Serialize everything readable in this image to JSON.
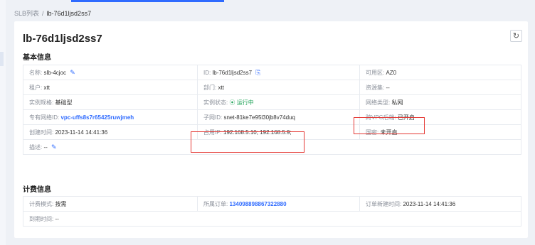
{
  "breadcrumb": {
    "parent": "SLB列表",
    "separator": "/",
    "current": "lb-76d1ljsd2ss7"
  },
  "page_title": "lb-76d1ljsd2ss7",
  "icons": {
    "refresh": "refresh-icon",
    "edit": "edit-icon",
    "copy": "copy-icon",
    "status": "running-status-icon"
  },
  "colors": {
    "accent": "#2f6bff",
    "link": "#2f6bff",
    "running": "#22a35a",
    "highlight": "#e53935"
  },
  "basic": {
    "title": "基本信息",
    "name": {
      "label": "名称:",
      "value": "slb-4cjoc"
    },
    "id": {
      "label": "ID:",
      "value": "lb-76d1ljsd2ss7"
    },
    "zone": {
      "label": "可用区:",
      "value": "AZ0"
    },
    "tenant": {
      "label": "租户:",
      "value": "xtt"
    },
    "dept": {
      "label": "部门:",
      "value": "xtt"
    },
    "resource_set": {
      "label": "资源集:",
      "value": "--"
    },
    "spec": {
      "label": "实例规格:",
      "value": "基础型"
    },
    "status": {
      "label": "实例状态:",
      "value": "运行中"
    },
    "network_type": {
      "label": "网络类型:",
      "value": "私网"
    },
    "vpc": {
      "label": "专有网络ID:",
      "value": "vpc-uffs8s7r65425ruwjmeh"
    },
    "subnet": {
      "label": "子网ID:",
      "value": "snet-81ke7e95l30jb8v74duq"
    },
    "cross_vpc": {
      "label": "跨VPC后端:",
      "value": "已开启"
    },
    "created": {
      "label": "创建时间:",
      "value": "2023-11-14 14:41:36"
    },
    "occupied_ip": {
      "label": "占用IP:",
      "value": "192.168.5.10;  192.168.5.9;"
    },
    "ipv6": {
      "label": "国密:",
      "value": "未开启"
    },
    "desc": {
      "label": "描述:",
      "value": "--"
    }
  },
  "billing": {
    "title": "计费信息",
    "mode": {
      "label": "计费模式:",
      "value": "按需"
    },
    "order": {
      "label": "所属订单:",
      "value": "134098898867322880"
    },
    "order_created": {
      "label": "订单新建时间:",
      "value": "2023-11-14 14:41:36"
    },
    "expire": {
      "label": "到期时间:",
      "value": "--"
    }
  }
}
